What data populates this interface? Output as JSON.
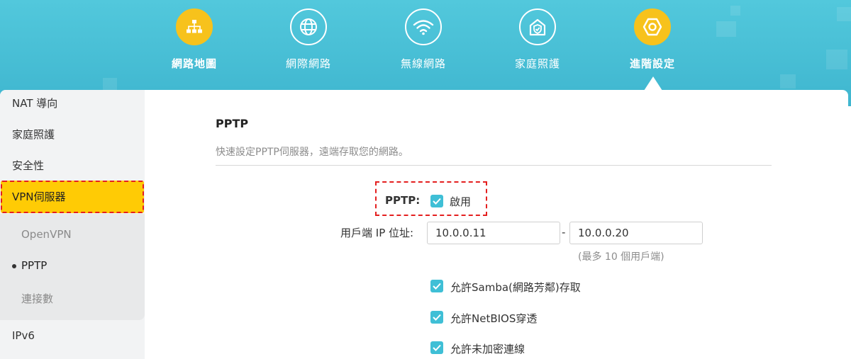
{
  "nav": {
    "items": [
      {
        "label": "網路地圖",
        "icon": "network-map-icon"
      },
      {
        "label": "網際網路",
        "icon": "globe-icon"
      },
      {
        "label": "無線網路",
        "icon": "wifi-icon"
      },
      {
        "label": "家庭照護",
        "icon": "home-shield-icon"
      },
      {
        "label": "進階設定",
        "icon": "settings-gear-icon"
      }
    ],
    "active_index": 4
  },
  "sidebar": {
    "items": [
      {
        "label": "NAT 導向"
      },
      {
        "label": "家庭照護"
      },
      {
        "label": "安全性"
      },
      {
        "label": "VPN伺服器"
      },
      {
        "label": "IPv6"
      }
    ],
    "vpn_subitems": [
      {
        "label": "OpenVPN"
      },
      {
        "label": "PPTP"
      },
      {
        "label": "連接數"
      }
    ],
    "active_subitem": "PPTP"
  },
  "main": {
    "title": "PPTP",
    "subtitle": "快速設定PPTP伺服器，遠端存取您的網路。",
    "pptp_label": "PPTP:",
    "enable_label": "啟用",
    "enable_checked": true,
    "client_ip_label": "用戶端 IP 位址:",
    "ip_start": "10.0.0.11",
    "ip_separator": "-",
    "ip_end": "10.0.0.20",
    "ip_hint": "(最多 10 個用戶端)",
    "options": [
      {
        "label": "允許Samba(網路芳鄰)存取",
        "checked": true
      },
      {
        "label": "允許NetBIOS穿透",
        "checked": true
      },
      {
        "label": "允許未加密連線",
        "checked": true
      }
    ]
  },
  "colors": {
    "header": "#47bdd4",
    "accent_yellow": "#f7c21c",
    "checkbox": "#3fbfd6",
    "highlight_border": "#e41f1f",
    "highlight_fill": "#ffcb05"
  }
}
